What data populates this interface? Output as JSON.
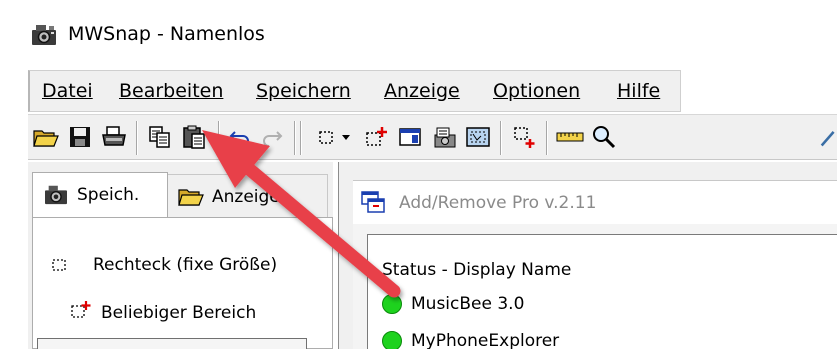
{
  "window": {
    "title": "MWSnap - Namenlos",
    "icon": "camera-icon"
  },
  "menubar": {
    "items": [
      {
        "label": "Datei",
        "accelerator_index": 0
      },
      {
        "label": "Bearbeiten",
        "accelerator_index": 0
      },
      {
        "label": "Speichern",
        "accelerator_index": 0
      },
      {
        "label": "Anzeige",
        "accelerator_index": 0
      },
      {
        "label": "Optionen",
        "accelerator_index": 0
      },
      {
        "label": "Hilfe",
        "accelerator_index": 0
      }
    ]
  },
  "toolbar": {
    "buttons": [
      "open-folder-icon",
      "save-disk-icon",
      "print-icon",
      "copy-icon",
      "paste-icon",
      "undo-icon",
      "redo-icon",
      "rectangle-capture-icon",
      "dropdown-arrow-icon",
      "any-area-capture-icon",
      "window-capture-icon",
      "menu-capture-icon",
      "full-screen-capture-icon",
      "add-frame-icon",
      "ruler-icon",
      "zoom-icon",
      "eyedropper-icon"
    ]
  },
  "left_panel": {
    "tabs": [
      {
        "label": "Speich.",
        "icon": "camera-icon",
        "active": true
      },
      {
        "label": "Anzeigen",
        "icon": "open-folder-icon",
        "active": false
      }
    ],
    "options": [
      {
        "label": "Rechteck (fixe Größe)",
        "icon": "dotted-rectangle-icon"
      },
      {
        "label": "Beliebiger Bereich",
        "icon": "dotted-rectangle-plus-icon"
      }
    ]
  },
  "canvas": {
    "inner_window_title": "Add/Remove Pro v.2.11",
    "list_header": "Status - Display Name",
    "rows": [
      {
        "name": "MusicBee 3.0",
        "status_color": "#1ed21e"
      },
      {
        "name": "MyPhoneExplorer",
        "status_color": "#1ed21e"
      }
    ]
  },
  "colors": {
    "annotation_arrow": "#e8404a",
    "status_ok": "#1ed21e"
  }
}
